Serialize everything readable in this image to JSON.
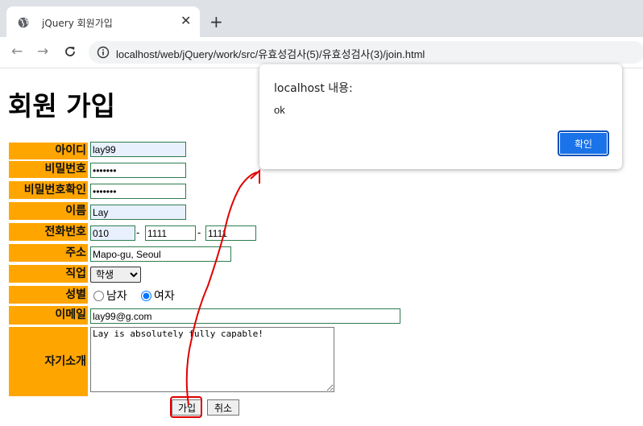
{
  "browser": {
    "tab_title": "jQuery 회원가입",
    "url": "localhost/web/jQuery/work/src/유효성검사(5)/유효성검사(3)/join.html",
    "icons": [
      "globe-icon",
      "close-icon",
      "plus-icon",
      "back-icon",
      "forward-icon",
      "reload-icon",
      "info-icon"
    ]
  },
  "page": {
    "title": "회원 가입",
    "form": {
      "id_label": "아이디",
      "id_value": "lay99",
      "pw_label": "비밀번호",
      "pw_value": "1234567",
      "pw_confirm_label": "비밀번호확인",
      "pw_confirm_value": "1234567",
      "name_label": "이름",
      "name_value": "Lay",
      "phone_label": "전화번호",
      "phone1": "010",
      "phone_sep": "-",
      "phone2": "1111",
      "phone3": "1111",
      "address_label": "주소",
      "address_value": "Mapo-gu, Seoul",
      "job_label": "직업",
      "job_selected": "학생",
      "gender_label": "성별",
      "gender_male": "남자",
      "gender_female": "여자",
      "gender_selected": "여자",
      "email_label": "이메일",
      "email_value": "lay99@g.com",
      "intro_label": "자기소개",
      "intro_value": "Lay is absolutely fully capable!",
      "submit_label": "가입",
      "cancel_label": "취소"
    }
  },
  "dialog": {
    "title": "localhost 내용:",
    "message": "ok",
    "ok_label": "확인",
    "colors": {
      "button": "#1a73e8"
    }
  },
  "colors": {
    "label_bg": "#ffa500",
    "annotation": "#e00000"
  }
}
